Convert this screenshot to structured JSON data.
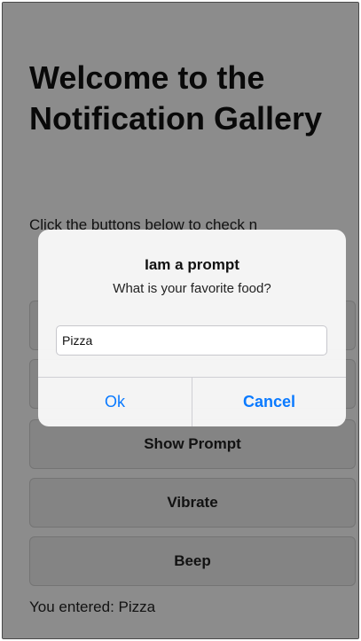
{
  "page": {
    "title": "Welcome to the Notification Gallery",
    "intro": "Click the buttons below to check n",
    "buttons": [
      "",
      "",
      "Show Prompt",
      "Vibrate",
      "Beep"
    ],
    "result_label": "You entered: Pizza"
  },
  "dialog": {
    "title": "Iam a prompt",
    "message": "What is your favorite food?",
    "input_value": "Pizza",
    "ok_label": "Ok",
    "cancel_label": "Cancel"
  },
  "colors": {
    "accent": "#0a7aff",
    "overlay": "rgba(0,0,0,0.45)"
  }
}
